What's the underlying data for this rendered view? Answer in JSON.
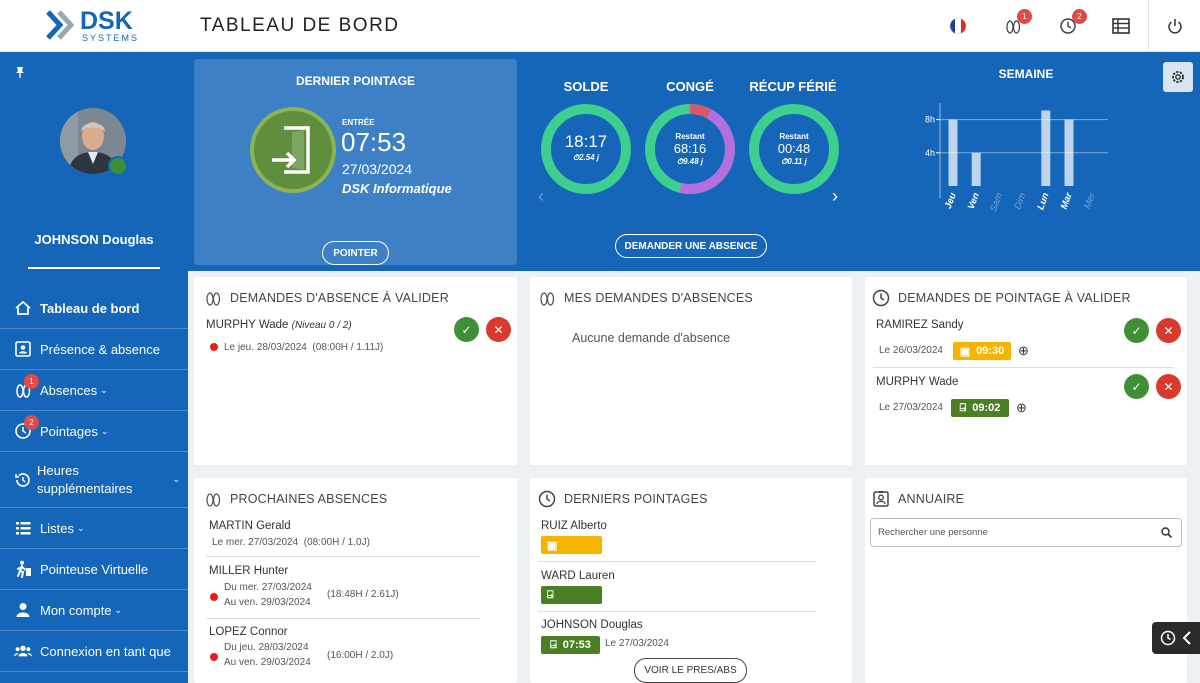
{
  "brand": {
    "name": "DSK",
    "sub": "SYSTEMS"
  },
  "header": {
    "title": "TABLEAU DE BORD",
    "absences_badge": "1",
    "pointages_badge": "2"
  },
  "user": {
    "name": "JOHNSON Douglas"
  },
  "nav": {
    "items": [
      {
        "label": "Tableau de bord"
      },
      {
        "label": "Présence & absence"
      },
      {
        "label": "Absences",
        "badge": "1"
      },
      {
        "label": "Pointages",
        "badge": "2"
      },
      {
        "label": "Heures supplémentaires"
      },
      {
        "label": "Listes"
      },
      {
        "label": "Pointeuse Virtuelle"
      },
      {
        "label": "Mon compte"
      },
      {
        "label": "Connexion en tant que"
      }
    ]
  },
  "last_punch": {
    "title": "DERNIER POINTAGE",
    "type": "ENTRÉE",
    "time": "07:53",
    "date": "27/03/2024",
    "company": "DSK Informatique",
    "button": "POINTER"
  },
  "gauges": [
    {
      "title": "SOLDE",
      "label": "",
      "value": "18:17",
      "days": "2.54 j"
    },
    {
      "title": "CONGÉ",
      "label": "Restant",
      "value": "68:16",
      "days": "9.48 j"
    },
    {
      "title": "RÉCUP FÉRIÉ",
      "label": "Restant",
      "value": "00:48",
      "days": "0.11 j"
    }
  ],
  "request_absence_button": "DEMANDER UNE ABSENCE",
  "chart_data": {
    "type": "bar",
    "title": "SEMAINE",
    "categories": [
      "Jeu",
      "Ven",
      "Sam",
      "Dim",
      "Lun",
      "Mar",
      "Mer"
    ],
    "values": [
      8,
      4,
      0,
      0,
      9.1,
      8,
      0
    ],
    "ytick_labels": [
      "8h",
      "4h"
    ],
    "ylim": [
      0,
      10
    ]
  },
  "cards": {
    "abs_to_validate": {
      "title": "DEMANDES D'ABSENCE À VALIDER",
      "name": "MURPHY Wade",
      "level": "(Niveau 0 / 2)",
      "detail": "Le jeu. 28/03/2024",
      "hours": "(08:00H / 1.11J)"
    },
    "my_abs": {
      "title": "MES DEMANDES D'ABSENCES",
      "empty": "Aucune demande d'absence"
    },
    "punch_to_validate": {
      "title": "DEMANDES DE POINTAGE À VALIDER",
      "rows": [
        {
          "name": "RAMIREZ Sandy",
          "date": "Le 26/03/2024",
          "time": "09:30"
        },
        {
          "name": "MURPHY Wade",
          "date": "Le 27/03/2024",
          "time": "09:02"
        }
      ]
    },
    "next_abs": {
      "title": "PROCHAINES ABSENCES",
      "rows": [
        {
          "name": "MARTIN Gerald",
          "line1": "Le mer. 27/03/2024",
          "line2": "",
          "hours": "(08:00H / 1.0J)"
        },
        {
          "name": "MILLER Hunter",
          "line1": "Du mer. 27/03/2024",
          "line2": "Au ven. 29/03/2024",
          "hours": "(18:48H / 2.61J)"
        },
        {
          "name": "LOPEZ Connor",
          "line1": "Du jeu. 28/03/2024",
          "line2": "Au ven. 29/03/2024",
          "hours": "(16:00H / 2.0J)"
        }
      ]
    },
    "last_punches": {
      "title": "DERNIERS POINTAGES",
      "rows": [
        {
          "name": "RUIZ Alberto",
          "time": "",
          "date": ""
        },
        {
          "name": "WARD Lauren",
          "time": "",
          "date": ""
        },
        {
          "name": "JOHNSON Douglas",
          "time": "07:53",
          "date": "Le 27/03/2024"
        }
      ],
      "button": "VOIR LE PRES/ABS"
    },
    "directory": {
      "title": "ANNUAIRE",
      "placeholder": "Rechercher une personne"
    }
  },
  "colors": {
    "primary": "#1565b8",
    "green": "#3f8f37",
    "red": "#d83a2e",
    "yellow": "#f4b400",
    "gauge_green": "#3ecf8e",
    "gauge_purple": "#b36ee0",
    "gauge_red": "#d8586b"
  }
}
